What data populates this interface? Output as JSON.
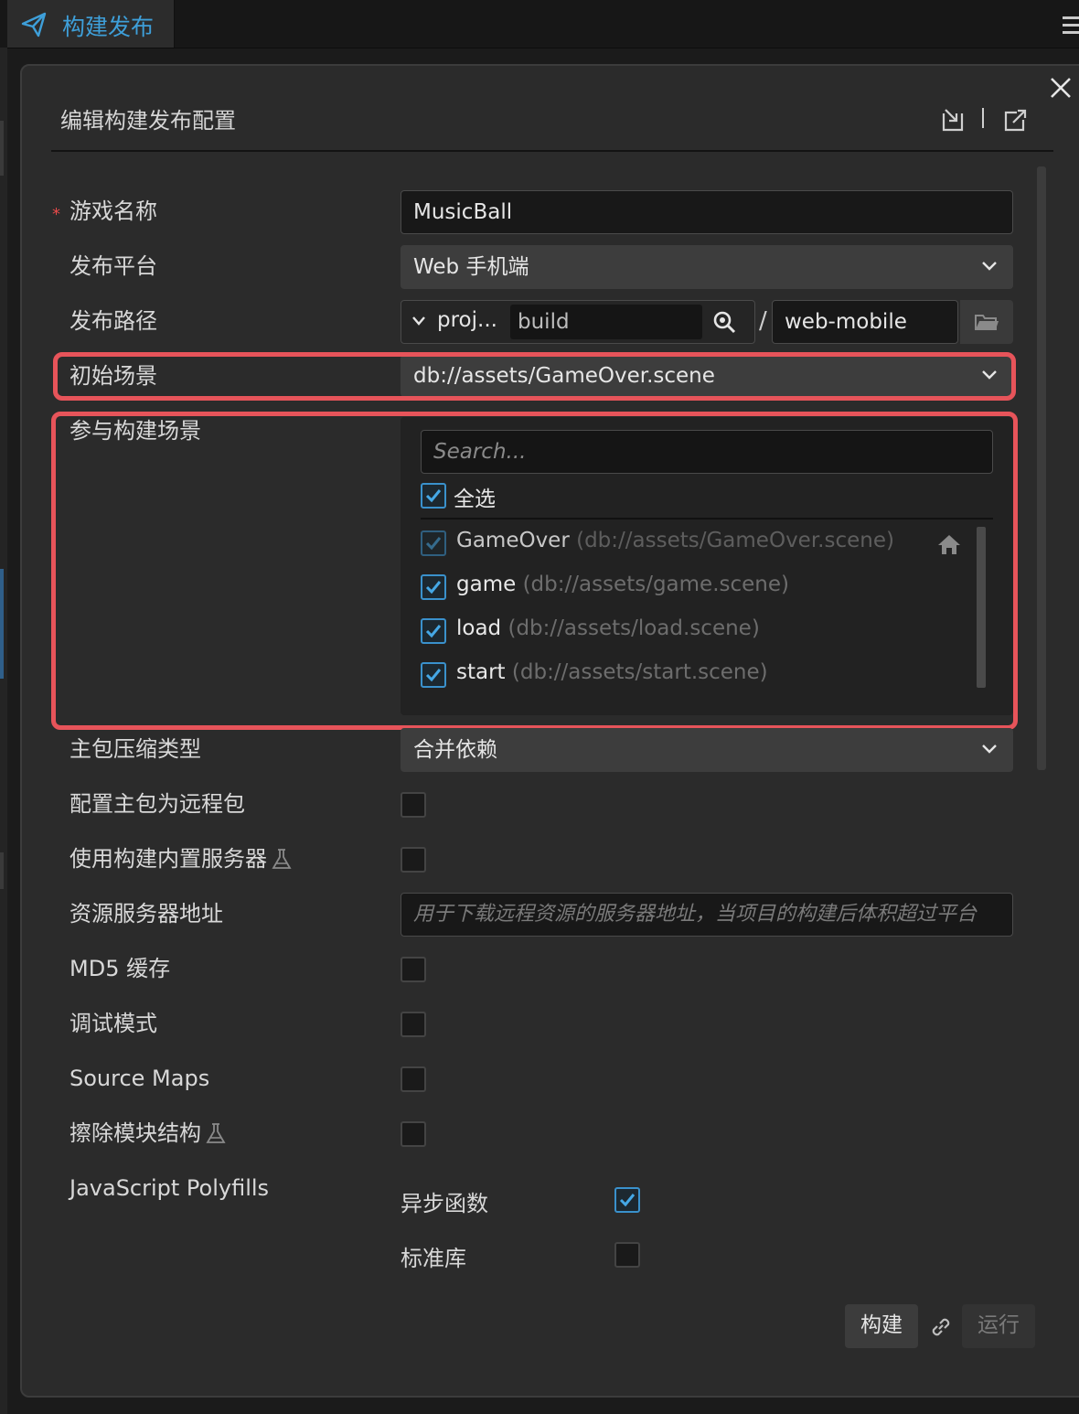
{
  "tab": {
    "title": "构建发布",
    "icon": "paper-plane-icon"
  },
  "dialog": {
    "title": "编辑构建发布配置",
    "icons": [
      "import-icon",
      "export-icon",
      "close-icon"
    ]
  },
  "form": {
    "game_name": {
      "label": "游戏名称",
      "required_mark": "*",
      "value": "MusicBall"
    },
    "platform": {
      "label": "发布平台",
      "value": "Web 手机端"
    },
    "build_path": {
      "label": "发布路径",
      "prefix": "proj...",
      "dir": "build",
      "separator": "/",
      "dest": "web-mobile"
    },
    "start_scene": {
      "label": "初始场景",
      "value": "db://assets/GameOver.scene"
    },
    "scenes": {
      "label": "参与构建场景",
      "search_placeholder": "Search...",
      "select_all_label": "全选",
      "items": [
        {
          "name": "GameOver",
          "path": "(db://assets/GameOver.scene)",
          "checked": true,
          "is_start": true
        },
        {
          "name": "game",
          "path": "(db://assets/game.scene)",
          "checked": true
        },
        {
          "name": "load",
          "path": "(db://assets/load.scene)",
          "checked": true
        },
        {
          "name": "start",
          "path": "(db://assets/start.scene)",
          "checked": true
        }
      ]
    },
    "main_bundle_compression": {
      "label": "主包压缩类型",
      "value": "合并依赖"
    },
    "remote_main_bundle": {
      "label": "配置主包为远程包",
      "checked": false
    },
    "builtin_server": {
      "label": "使用构建内置服务器",
      "checked": false
    },
    "resource_server": {
      "label": "资源服务器地址",
      "placeholder": "用于下载远程资源的服务器地址，当项目的构建后体积超过平台"
    },
    "md5_cache": {
      "label": "MD5 缓存",
      "checked": false
    },
    "debug_mode": {
      "label": "调试模式",
      "checked": false
    },
    "source_maps": {
      "label": "Source Maps",
      "checked": false
    },
    "erase_module": {
      "label": "擦除模块结构",
      "checked": false
    },
    "polyfills": {
      "label": "JavaScript Polyfills",
      "async_functions": {
        "label": "异步函数",
        "checked": true
      },
      "core_js": {
        "label": "标准库",
        "checked": false
      }
    }
  },
  "actions": {
    "build_label": "构建",
    "run_label": "运行"
  },
  "colors": {
    "accent": "#3e9fd9",
    "highlight": "#e7545a",
    "background": "#2b2b2b"
  }
}
